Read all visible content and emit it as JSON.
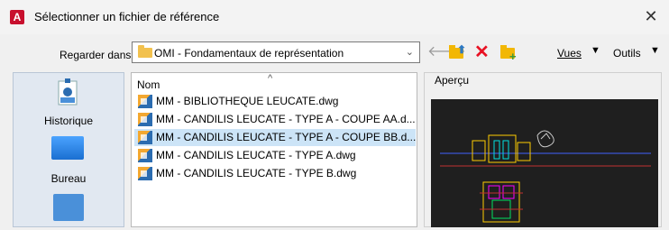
{
  "window": {
    "title": "Sélectionner un fichier de référence",
    "app_icon_letter": "A"
  },
  "lookin": {
    "label": "Regarder dans:",
    "value": "OMI - Fondamentaux de représentation"
  },
  "toolbar": {
    "vues_label": "Vues",
    "outils_label": "Outils"
  },
  "places": [
    {
      "label": "Historique",
      "icon": "history-icon"
    },
    {
      "label": "Bureau",
      "icon": "desktop-icon"
    },
    {
      "label": "",
      "icon": "documents-icon"
    }
  ],
  "filelist": {
    "column": "Nom",
    "sort_indicator": "^",
    "files": [
      {
        "name": "MM - BIBLIOTHEQUE LEUCATE.dwg",
        "selected": false
      },
      {
        "name": "MM - CANDILIS LEUCATE - TYPE A - COUPE AA.d...",
        "selected": false
      },
      {
        "name": "MM - CANDILIS LEUCATE - TYPE A - COUPE BB.d...",
        "selected": true
      },
      {
        "name": "MM - CANDILIS LEUCATE - TYPE A.dwg",
        "selected": false
      },
      {
        "name": "MM - CANDILIS LEUCATE - TYPE B.dwg",
        "selected": false
      }
    ]
  },
  "preview": {
    "label": "Aperçu"
  },
  "colors": {
    "selection": "#cce4f7",
    "accent": "#c8102e",
    "preview_bg": "#1f1f1f"
  }
}
